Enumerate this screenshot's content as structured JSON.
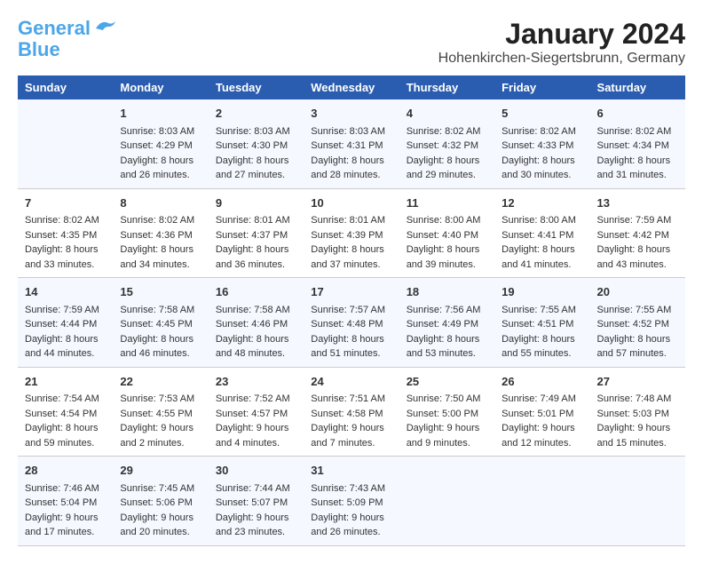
{
  "header": {
    "logo_line1": "General",
    "logo_line2": "Blue",
    "title": "January 2024",
    "subtitle": "Hohenkirchen-Siegertsbrunn, Germany"
  },
  "columns": [
    "Sunday",
    "Monday",
    "Tuesday",
    "Wednesday",
    "Thursday",
    "Friday",
    "Saturday"
  ],
  "weeks": [
    [
      {
        "day": "",
        "info": ""
      },
      {
        "day": "1",
        "info": "Sunrise: 8:03 AM\nSunset: 4:29 PM\nDaylight: 8 hours\nand 26 minutes."
      },
      {
        "day": "2",
        "info": "Sunrise: 8:03 AM\nSunset: 4:30 PM\nDaylight: 8 hours\nand 27 minutes."
      },
      {
        "day": "3",
        "info": "Sunrise: 8:03 AM\nSunset: 4:31 PM\nDaylight: 8 hours\nand 28 minutes."
      },
      {
        "day": "4",
        "info": "Sunrise: 8:02 AM\nSunset: 4:32 PM\nDaylight: 8 hours\nand 29 minutes."
      },
      {
        "day": "5",
        "info": "Sunrise: 8:02 AM\nSunset: 4:33 PM\nDaylight: 8 hours\nand 30 minutes."
      },
      {
        "day": "6",
        "info": "Sunrise: 8:02 AM\nSunset: 4:34 PM\nDaylight: 8 hours\nand 31 minutes."
      }
    ],
    [
      {
        "day": "7",
        "info": "Sunrise: 8:02 AM\nSunset: 4:35 PM\nDaylight: 8 hours\nand 33 minutes."
      },
      {
        "day": "8",
        "info": "Sunrise: 8:02 AM\nSunset: 4:36 PM\nDaylight: 8 hours\nand 34 minutes."
      },
      {
        "day": "9",
        "info": "Sunrise: 8:01 AM\nSunset: 4:37 PM\nDaylight: 8 hours\nand 36 minutes."
      },
      {
        "day": "10",
        "info": "Sunrise: 8:01 AM\nSunset: 4:39 PM\nDaylight: 8 hours\nand 37 minutes."
      },
      {
        "day": "11",
        "info": "Sunrise: 8:00 AM\nSunset: 4:40 PM\nDaylight: 8 hours\nand 39 minutes."
      },
      {
        "day": "12",
        "info": "Sunrise: 8:00 AM\nSunset: 4:41 PM\nDaylight: 8 hours\nand 41 minutes."
      },
      {
        "day": "13",
        "info": "Sunrise: 7:59 AM\nSunset: 4:42 PM\nDaylight: 8 hours\nand 43 minutes."
      }
    ],
    [
      {
        "day": "14",
        "info": "Sunrise: 7:59 AM\nSunset: 4:44 PM\nDaylight: 8 hours\nand 44 minutes."
      },
      {
        "day": "15",
        "info": "Sunrise: 7:58 AM\nSunset: 4:45 PM\nDaylight: 8 hours\nand 46 minutes."
      },
      {
        "day": "16",
        "info": "Sunrise: 7:58 AM\nSunset: 4:46 PM\nDaylight: 8 hours\nand 48 minutes."
      },
      {
        "day": "17",
        "info": "Sunrise: 7:57 AM\nSunset: 4:48 PM\nDaylight: 8 hours\nand 51 minutes."
      },
      {
        "day": "18",
        "info": "Sunrise: 7:56 AM\nSunset: 4:49 PM\nDaylight: 8 hours\nand 53 minutes."
      },
      {
        "day": "19",
        "info": "Sunrise: 7:55 AM\nSunset: 4:51 PM\nDaylight: 8 hours\nand 55 minutes."
      },
      {
        "day": "20",
        "info": "Sunrise: 7:55 AM\nSunset: 4:52 PM\nDaylight: 8 hours\nand 57 minutes."
      }
    ],
    [
      {
        "day": "21",
        "info": "Sunrise: 7:54 AM\nSunset: 4:54 PM\nDaylight: 8 hours\nand 59 minutes."
      },
      {
        "day": "22",
        "info": "Sunrise: 7:53 AM\nSunset: 4:55 PM\nDaylight: 9 hours\nand 2 minutes."
      },
      {
        "day": "23",
        "info": "Sunrise: 7:52 AM\nSunset: 4:57 PM\nDaylight: 9 hours\nand 4 minutes."
      },
      {
        "day": "24",
        "info": "Sunrise: 7:51 AM\nSunset: 4:58 PM\nDaylight: 9 hours\nand 7 minutes."
      },
      {
        "day": "25",
        "info": "Sunrise: 7:50 AM\nSunset: 5:00 PM\nDaylight: 9 hours\nand 9 minutes."
      },
      {
        "day": "26",
        "info": "Sunrise: 7:49 AM\nSunset: 5:01 PM\nDaylight: 9 hours\nand 12 minutes."
      },
      {
        "day": "27",
        "info": "Sunrise: 7:48 AM\nSunset: 5:03 PM\nDaylight: 9 hours\nand 15 minutes."
      }
    ],
    [
      {
        "day": "28",
        "info": "Sunrise: 7:46 AM\nSunset: 5:04 PM\nDaylight: 9 hours\nand 17 minutes."
      },
      {
        "day": "29",
        "info": "Sunrise: 7:45 AM\nSunset: 5:06 PM\nDaylight: 9 hours\nand 20 minutes."
      },
      {
        "day": "30",
        "info": "Sunrise: 7:44 AM\nSunset: 5:07 PM\nDaylight: 9 hours\nand 23 minutes."
      },
      {
        "day": "31",
        "info": "Sunrise: 7:43 AM\nSunset: 5:09 PM\nDaylight: 9 hours\nand 26 minutes."
      },
      {
        "day": "",
        "info": ""
      },
      {
        "day": "",
        "info": ""
      },
      {
        "day": "",
        "info": ""
      }
    ]
  ]
}
